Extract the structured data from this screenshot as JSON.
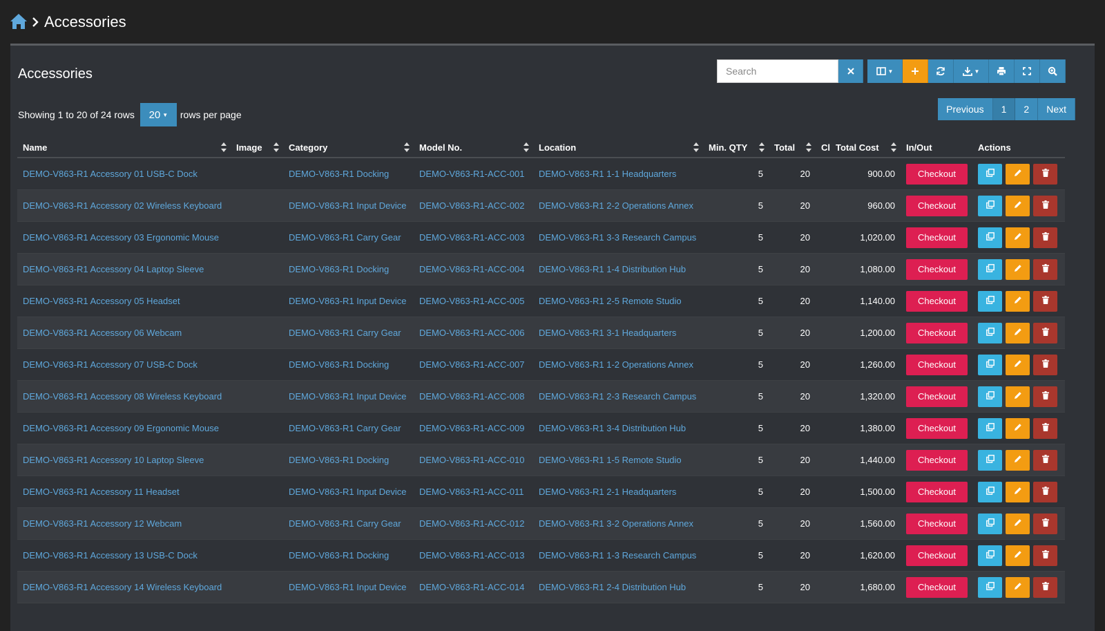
{
  "breadcrumb": {
    "title": "Accessories"
  },
  "panel": {
    "title": "Accessories",
    "search": {
      "placeholder": "Search",
      "value": ""
    },
    "showing_text": "Showing 1 to 20 of 24 rows",
    "page_size": "20",
    "rows_per_page_text": "rows per page",
    "pager": {
      "previous": "Previous",
      "pages": [
        "1",
        "2"
      ],
      "current": "1",
      "next": "Next"
    }
  },
  "colors": {
    "primary": "#3c8dbc",
    "warning": "#f39c12",
    "checkout": "#dd1f52",
    "info": "#39b3e0",
    "danger": "#a9372d",
    "link": "#5fa8dc"
  },
  "table": {
    "headers": [
      "Name",
      "Image",
      "Category",
      "Model No.",
      "Location",
      "Min. QTY",
      "Total",
      "Cl",
      "Total Cost",
      "In/Out",
      "Actions"
    ],
    "checkout_label": "Checkout",
    "rows": [
      {
        "name": "DEMO-V863-R1 Accessory 01 USB-C Dock",
        "category": "DEMO-V863-R1 Docking",
        "model": "DEMO-V863-R1-ACC-001",
        "location": "DEMO-V863-R1 1-1 Headquarters",
        "min_qty": "5",
        "total": "20",
        "cost": "900.00"
      },
      {
        "name": "DEMO-V863-R1 Accessory 02 Wireless Keyboard",
        "category": "DEMO-V863-R1 Input Device",
        "model": "DEMO-V863-R1-ACC-002",
        "location": "DEMO-V863-R1 2-2 Operations Annex",
        "min_qty": "5",
        "total": "20",
        "cost": "960.00"
      },
      {
        "name": "DEMO-V863-R1 Accessory 03 Ergonomic Mouse",
        "category": "DEMO-V863-R1 Carry Gear",
        "model": "DEMO-V863-R1-ACC-003",
        "location": "DEMO-V863-R1 3-3 Research Campus",
        "min_qty": "5",
        "total": "20",
        "cost": "1,020.00"
      },
      {
        "name": "DEMO-V863-R1 Accessory 04 Laptop Sleeve",
        "category": "DEMO-V863-R1 Docking",
        "model": "DEMO-V863-R1-ACC-004",
        "location": "DEMO-V863-R1 1-4 Distribution Hub",
        "min_qty": "5",
        "total": "20",
        "cost": "1,080.00"
      },
      {
        "name": "DEMO-V863-R1 Accessory 05 Headset",
        "category": "DEMO-V863-R1 Input Device",
        "model": "DEMO-V863-R1-ACC-005",
        "location": "DEMO-V863-R1 2-5 Remote Studio",
        "min_qty": "5",
        "total": "20",
        "cost": "1,140.00"
      },
      {
        "name": "DEMO-V863-R1 Accessory 06 Webcam",
        "category": "DEMO-V863-R1 Carry Gear",
        "model": "DEMO-V863-R1-ACC-006",
        "location": "DEMO-V863-R1 3-1 Headquarters",
        "min_qty": "5",
        "total": "20",
        "cost": "1,200.00"
      },
      {
        "name": "DEMO-V863-R1 Accessory 07 USB-C Dock",
        "category": "DEMO-V863-R1 Docking",
        "model": "DEMO-V863-R1-ACC-007",
        "location": "DEMO-V863-R1 1-2 Operations Annex",
        "min_qty": "5",
        "total": "20",
        "cost": "1,260.00"
      },
      {
        "name": "DEMO-V863-R1 Accessory 08 Wireless Keyboard",
        "category": "DEMO-V863-R1 Input Device",
        "model": "DEMO-V863-R1-ACC-008",
        "location": "DEMO-V863-R1 2-3 Research Campus",
        "min_qty": "5",
        "total": "20",
        "cost": "1,320.00"
      },
      {
        "name": "DEMO-V863-R1 Accessory 09 Ergonomic Mouse",
        "category": "DEMO-V863-R1 Carry Gear",
        "model": "DEMO-V863-R1-ACC-009",
        "location": "DEMO-V863-R1 3-4 Distribution Hub",
        "min_qty": "5",
        "total": "20",
        "cost": "1,380.00"
      },
      {
        "name": "DEMO-V863-R1 Accessory 10 Laptop Sleeve",
        "category": "DEMO-V863-R1 Docking",
        "model": "DEMO-V863-R1-ACC-010",
        "location": "DEMO-V863-R1 1-5 Remote Studio",
        "min_qty": "5",
        "total": "20",
        "cost": "1,440.00"
      },
      {
        "name": "DEMO-V863-R1 Accessory 11 Headset",
        "category": "DEMO-V863-R1 Input Device",
        "model": "DEMO-V863-R1-ACC-011",
        "location": "DEMO-V863-R1 2-1 Headquarters",
        "min_qty": "5",
        "total": "20",
        "cost": "1,500.00"
      },
      {
        "name": "DEMO-V863-R1 Accessory 12 Webcam",
        "category": "DEMO-V863-R1 Carry Gear",
        "model": "DEMO-V863-R1-ACC-012",
        "location": "DEMO-V863-R1 3-2 Operations Annex",
        "min_qty": "5",
        "total": "20",
        "cost": "1,560.00"
      },
      {
        "name": "DEMO-V863-R1 Accessory 13 USB-C Dock",
        "category": "DEMO-V863-R1 Docking",
        "model": "DEMO-V863-R1-ACC-013",
        "location": "DEMO-V863-R1 1-3 Research Campus",
        "min_qty": "5",
        "total": "20",
        "cost": "1,620.00"
      },
      {
        "name": "DEMO-V863-R1 Accessory 14 Wireless Keyboard",
        "category": "DEMO-V863-R1 Input Device",
        "model": "DEMO-V863-R1-ACC-014",
        "location": "DEMO-V863-R1 2-4 Distribution Hub",
        "min_qty": "5",
        "total": "20",
        "cost": "1,680.00"
      }
    ]
  }
}
